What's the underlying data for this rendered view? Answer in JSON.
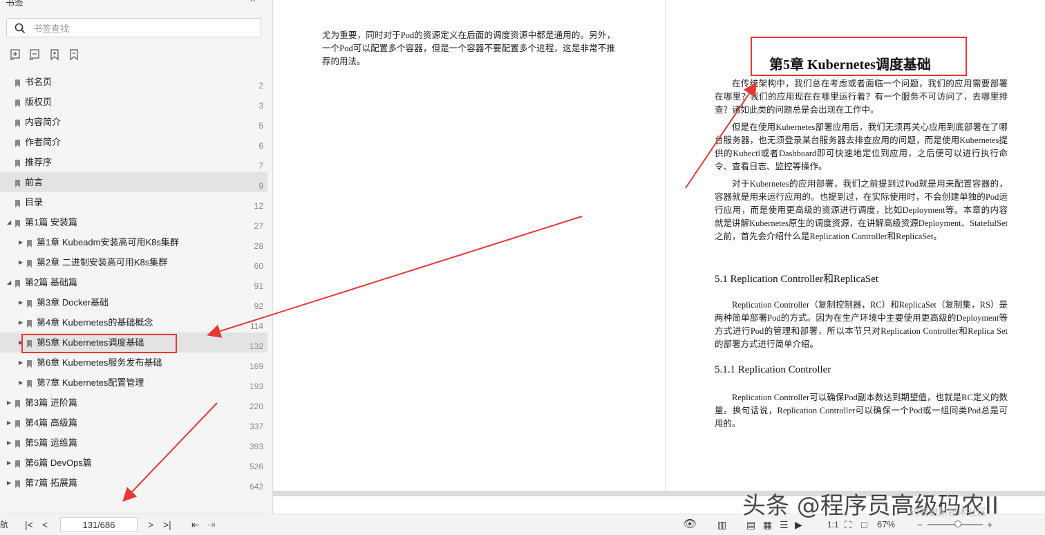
{
  "sidebar": {
    "title": "书签",
    "search_placeholder": "书签查找",
    "items": [
      {
        "label": "书名页",
        "page": "2",
        "level": 0,
        "expand": ""
      },
      {
        "label": "版权页",
        "page": "3",
        "level": 0,
        "expand": ""
      },
      {
        "label": "内容简介",
        "page": "5",
        "level": 0,
        "expand": ""
      },
      {
        "label": "作者简介",
        "page": "6",
        "level": 0,
        "expand": ""
      },
      {
        "label": "推荐序",
        "page": "7",
        "level": 0,
        "expand": ""
      },
      {
        "label": "前言",
        "page": "9",
        "level": 0,
        "expand": "",
        "selected": true
      },
      {
        "label": "目录",
        "page": "12",
        "level": 0,
        "expand": ""
      },
      {
        "label": "第1篇 安装篇",
        "page": "27",
        "level": 0,
        "expand": "open"
      },
      {
        "label": "第1章 Kubeadm安装高可用K8s集群",
        "page": "28",
        "level": 1,
        "expand": "closed"
      },
      {
        "label": "第2章 二进制安装高可用K8s集群",
        "page": "60",
        "level": 1,
        "expand": "closed"
      },
      {
        "label": "第2篇 基础篇",
        "page": "91",
        "level": 0,
        "expand": "open"
      },
      {
        "label": "第3章 Docker基础",
        "page": "92",
        "level": 1,
        "expand": "closed"
      },
      {
        "label": "第4章 Kubernetes的基础概念",
        "page": "114",
        "level": 1,
        "expand": "closed"
      },
      {
        "label": "第5章 Kubernetes调度基础",
        "page": "132",
        "level": 1,
        "expand": "closed",
        "selected": true
      },
      {
        "label": "第6章 Kubernetes服务发布基础",
        "page": "169",
        "level": 1,
        "expand": "closed"
      },
      {
        "label": "第7章 Kubernetes配置管理",
        "page": "193",
        "level": 1,
        "expand": "closed"
      },
      {
        "label": "第3篇 进阶篇",
        "page": "220",
        "level": 0,
        "expand": "closed"
      },
      {
        "label": "第4篇 高级篇",
        "page": "337",
        "level": 0,
        "expand": "closed"
      },
      {
        "label": "第5篇 运维篇",
        "page": "393",
        "level": 0,
        "expand": "closed"
      },
      {
        "label": "第6篇 DevOps篇",
        "page": "526",
        "level": 0,
        "expand": "closed"
      },
      {
        "label": "第7篇 拓展篇",
        "page": "642",
        "level": 0,
        "expand": "closed"
      }
    ]
  },
  "bottom_bar": {
    "nav_label": "航",
    "page_indicator": "131/686",
    "zoom_label": "67%",
    "zoom_fraction": 0.55
  },
  "left_page": {
    "paragraph": "尤为重要，同时对于Pod的资源定义在后面的调度资源中都是通用的。另外，一个Pod可以配置多个容器，但是一个容器不要配置多个进程，这是非常不推荐的用法。"
  },
  "right_page": {
    "chapter_title": "第5章  Kubernetes调度基础",
    "p1": "在传统架构中，我们总在考虑或者面临一个问题，我们的应用需要部署在哪里？我们的应用现在在哪里运行着？有一个服务不可访问了，去哪里排查？诸如此类的问题总是会出现在工作中。",
    "p2": "但是在使用Kubernetes部署应用后，我们无须再关心应用到底部署在了哪台服务器，也无须登录某台服务器去排查应用的问题，而是使用Kubernetes提供的Kubectl或者Dashboard即可快速地定位到应用，之后便可以进行执行命令、查看日志、监控等操作。",
    "p3": "对于Kubernetes的应用部署，我们之前提到过Pod就是用来配置容器的，容器就是用来运行应用的。也提到过，在实际使用时，不会创建单独的Pod运行应用，而是使用更高级的资源进行调度，比如Deployment等。本章的内容就是讲解Kubernetes原生的调度资源，在讲解高级资源Deployment、StatefulSet之前，首先会介绍什么是Replication Controller和ReplicaSet。",
    "sec1": "5.1  Replication Controller和ReplicaSet",
    "p4": "Replication Controller（复制控制器，RC）和ReplicaSet（复制集，RS）是两种简单部署Pod的方式。因为在生产环境中主要使用更高级的Deployment等方式进行Pod的管理和部署，所以本节只对Replication Controller和Replica Set的部署方式进行简单介绍。",
    "sec2": "5.1.1  Replication Controller",
    "p5": "Replication Controller可以确保Pod副本数达到期望值，也就是RC定义的数量。换句话说，Replication Controller可以确保一个Pod或一组同类Pod总是可用的。"
  },
  "watermark": {
    "text": "头条 @程序员高级码农II",
    "sub": "码农进阶技术社区"
  },
  "colors": {
    "annotation_red": "#e53935"
  }
}
